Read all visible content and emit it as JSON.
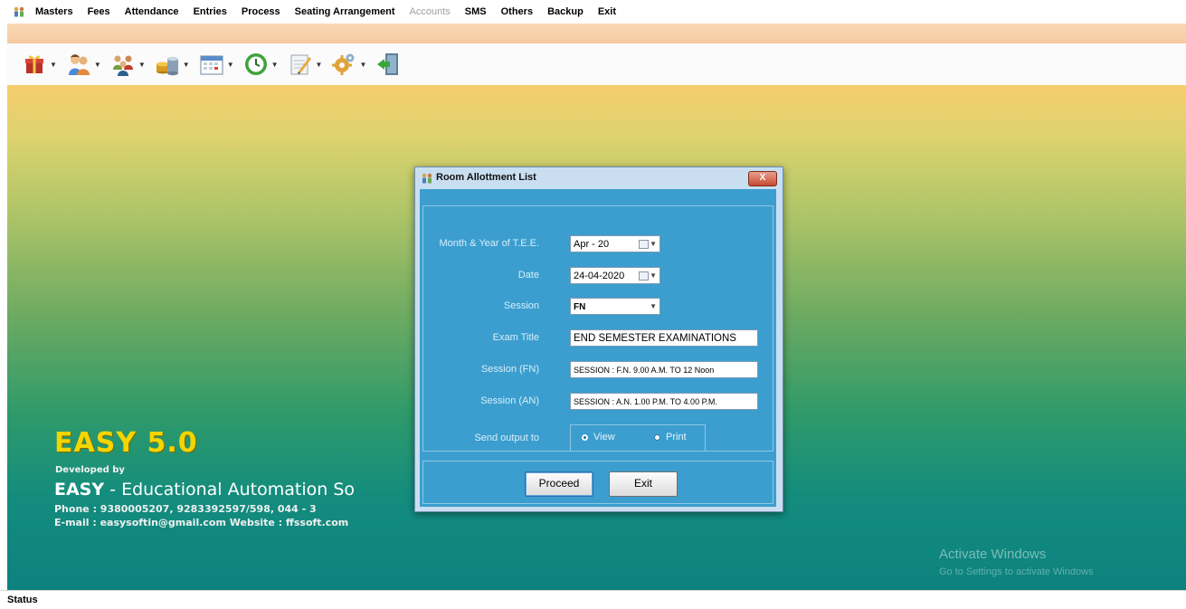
{
  "menu": {
    "items": [
      {
        "label": "Masters",
        "disabled": false
      },
      {
        "label": "Fees",
        "disabled": false
      },
      {
        "label": "Attendance",
        "disabled": false
      },
      {
        "label": "Entries",
        "disabled": false
      },
      {
        "label": "Process",
        "disabled": false
      },
      {
        "label": "Seating Arrangement",
        "disabled": false
      },
      {
        "label": "Accounts",
        "disabled": true
      },
      {
        "label": "SMS",
        "disabled": false
      },
      {
        "label": "Others",
        "disabled": false
      },
      {
        "label": "Backup",
        "disabled": false
      },
      {
        "label": "Exit",
        "disabled": false
      }
    ]
  },
  "toolbar": {
    "buttons": [
      {
        "icon": "gift-icon"
      },
      {
        "icon": "users-icon"
      },
      {
        "icon": "group-icon"
      },
      {
        "icon": "coins-icon"
      },
      {
        "icon": "calendar-icon"
      },
      {
        "icon": "clock-icon"
      },
      {
        "icon": "notepad-icon"
      },
      {
        "icon": "settings-icon"
      },
      {
        "icon": "exit-door-icon"
      }
    ]
  },
  "desktop": {
    "brand_title": "EASY 5.0",
    "developed_by": "Developed by",
    "brand_name": "EASY",
    "brand_rest": " - Educational Automation So",
    "phone": "Phone : 9380005207, 9283392597/598, 044 - 3",
    "email": "E-mail : easysoftin@gmail.com     Website : ffssoft.com",
    "watermark_line1": "Activate Windows",
    "watermark_line2": "Go to Settings to activate Windows"
  },
  "dialog": {
    "title": "Room Allottment List",
    "close_label": "X",
    "fields": {
      "month_year": {
        "label": "Month & Year of T.E.E.",
        "value": "Apr  - 20"
      },
      "date": {
        "label": "Date",
        "value": "24-04-2020"
      },
      "session": {
        "label": "Session",
        "value": "FN"
      },
      "exam_title": {
        "label": "Exam Title",
        "value": "END SEMESTER EXAMINATIONS"
      },
      "session_fn": {
        "label": "Session (FN)",
        "value": "SESSION : F.N. 9.00 A.M. TO 12 Noon"
      },
      "session_an": {
        "label": "Session (AN)",
        "value": "SESSION : A.N. 1.00 P.M. TO 4.00 P.M."
      }
    },
    "output": {
      "label": "Send output to",
      "options": [
        "View",
        "Print"
      ],
      "selected": "View"
    },
    "buttons": {
      "proceed": "Proceed",
      "exit": "Exit"
    }
  },
  "status": {
    "text": "Status"
  },
  "colors": {
    "dialog_body": "#3b9ecf",
    "brand_title": "#f5d500"
  }
}
